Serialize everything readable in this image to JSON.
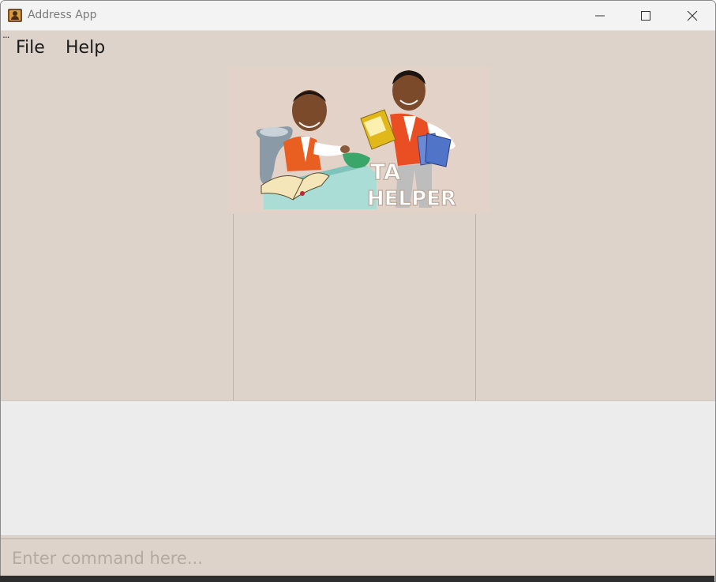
{
  "window": {
    "title": "Address App",
    "icon": "address-book-icon",
    "controls": [
      "minimize-icon",
      "maximize-icon",
      "close-icon"
    ]
  },
  "menu": {
    "overflow": "...",
    "items": [
      {
        "label": "File"
      },
      {
        "label": "Help"
      }
    ]
  },
  "banner": {
    "text_line1": "TA",
    "text_line2": "HELPER"
  },
  "command": {
    "placeholder": "Enter command here...",
    "value": ""
  },
  "colors": {
    "background": "#ddd3ca",
    "result_background": "#ececec",
    "titlebar": "#f3f3f3"
  }
}
